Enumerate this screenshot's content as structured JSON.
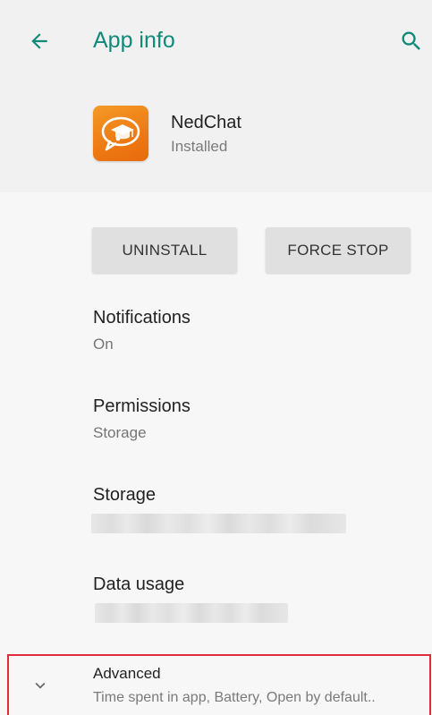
{
  "appbar": {
    "title": "App info",
    "back_icon": "arrow-left-icon",
    "search_icon": "search-icon",
    "accent_color": "#0f8a78"
  },
  "app": {
    "name": "NedChat",
    "status": "Installed",
    "icon": "nedchat-app-icon",
    "icon_color": "#ef7f17"
  },
  "actions": {
    "uninstall_label": "UNINSTALL",
    "force_stop_label": "FORCE STOP"
  },
  "settings": [
    {
      "title": "Notifications",
      "subtitle": "On"
    },
    {
      "title": "Permissions",
      "subtitle": "Storage"
    },
    {
      "title": "Storage",
      "subtitle": ""
    },
    {
      "title": "Data usage",
      "subtitle": ""
    }
  ],
  "advanced": {
    "title": "Advanced",
    "subtitle": "Time spent in app, Battery, Open by default..",
    "chevron_icon": "chevron-down-icon",
    "highlight_color": "#e02b3c"
  }
}
